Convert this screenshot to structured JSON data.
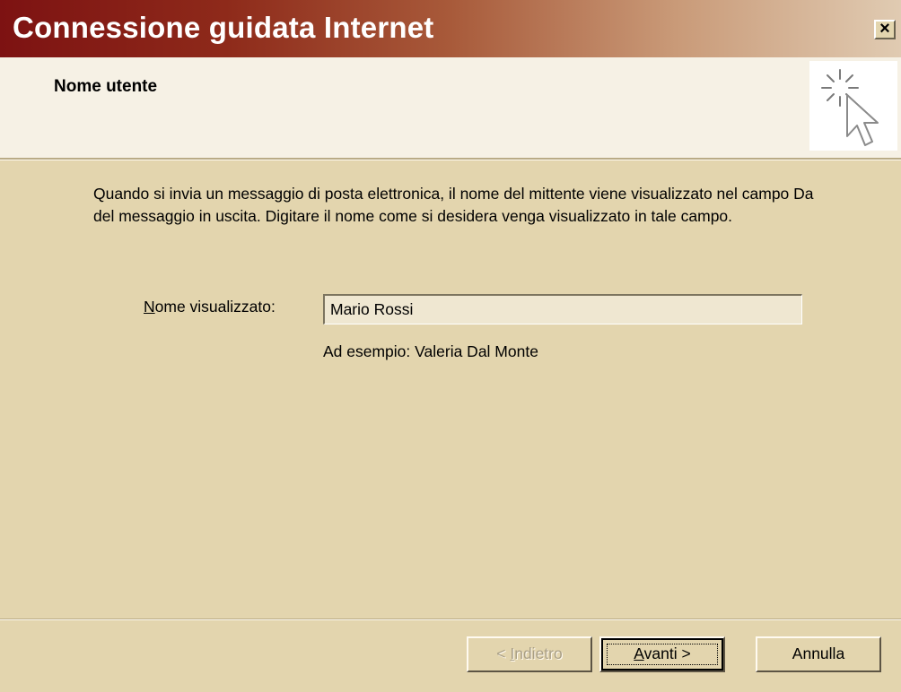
{
  "window": {
    "title": "Connessione guidata Internet",
    "close_label": "×"
  },
  "header": {
    "title": "Nome utente",
    "icon": "wizard-cursor-icon"
  },
  "body": {
    "description": "Quando si invia un messaggio di posta elettronica, il nome del mittente viene visualizzato nel campo Da del messaggio in uscita. Digitare il nome come si desidera venga visualizzato in tale campo.",
    "field_label_accel": "N",
    "field_label_rest": "ome visualizzato:",
    "field_value": "Mario Rossi",
    "example": "Ad esempio: Valeria Dal Monte"
  },
  "footer": {
    "back_prefix": "< ",
    "back_accel": "I",
    "back_rest": "ndietro",
    "next_accel": "A",
    "next_rest": "vanti >",
    "cancel_label": "Annulla"
  },
  "colors": {
    "titlebar_start": "#7d1212",
    "titlebar_end": "#e0cbb2",
    "dialog_bg": "#e3d5ae",
    "header_bg": "#f6f1e5"
  }
}
